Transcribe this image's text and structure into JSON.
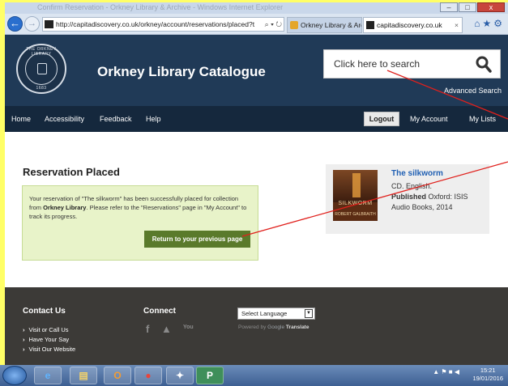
{
  "browser": {
    "title_faded": "Confirm Reservation - Orkney Library & Archive - Windows Internet Explorer",
    "url": "http://capitadiscovery.co.uk/orkney/account/reservations/placed?t",
    "url_tools": "⌕ ▾ ↻",
    "tabs": [
      {
        "label": "Orkney Library & Archive - We..."
      },
      {
        "label": "capitadiscovery.co.uk"
      }
    ],
    "tab_close": "×",
    "window_buttons": [
      "–",
      "□",
      "x"
    ]
  },
  "site": {
    "logo_text_top": "THE ORKNEY LIBRARY",
    "logo_text_bottom": "1683",
    "title": "Orkney Library Catalogue",
    "search_placeholder": "Click here to search",
    "advanced_search": "Advanced Search"
  },
  "nav": {
    "left": [
      "Home",
      "Accessibility",
      "Feedback",
      "Help"
    ],
    "logout": "Logout",
    "my_account": "My Account",
    "my_lists": "My Lists"
  },
  "reservation": {
    "heading": "Reservation Placed",
    "message_pre": "Your reservation of \"The silkworm\" has been successfully placed for collection from ",
    "message_library": "Orkney Library",
    "message_post": ". Please refer to the \"Reservations\" page in \"My Account\" to track its progress.",
    "return_button": "Return to your previous page"
  },
  "book": {
    "title": "The silkworm",
    "format": "CD. English.",
    "published_label": "Published",
    "published_value": " Oxford: ISIS",
    "published_value_2": "Audio Books, 2014",
    "cover_title": "SILKWORM",
    "cover_author": "ROBERT GALBRAITH"
  },
  "footer": {
    "contact_heading": "Contact Us",
    "contact_links": [
      "Visit or Call Us",
      "Have Your Say",
      "Visit Our Website"
    ],
    "connect_heading": "Connect",
    "social": [
      "f",
      "🐦",
      "You"
    ],
    "language_select": "Select Language",
    "powered_by": "Powered by",
    "google": "Google",
    "translate": "Translate"
  },
  "taskbar": {
    "apps": [
      "e",
      "▤",
      "O",
      "●",
      "✦",
      "P"
    ],
    "tray": "▲  ⚑  ■  ◀",
    "time": "15:21",
    "date": "19/01/2016"
  },
  "annotation_color": "#e0201c"
}
